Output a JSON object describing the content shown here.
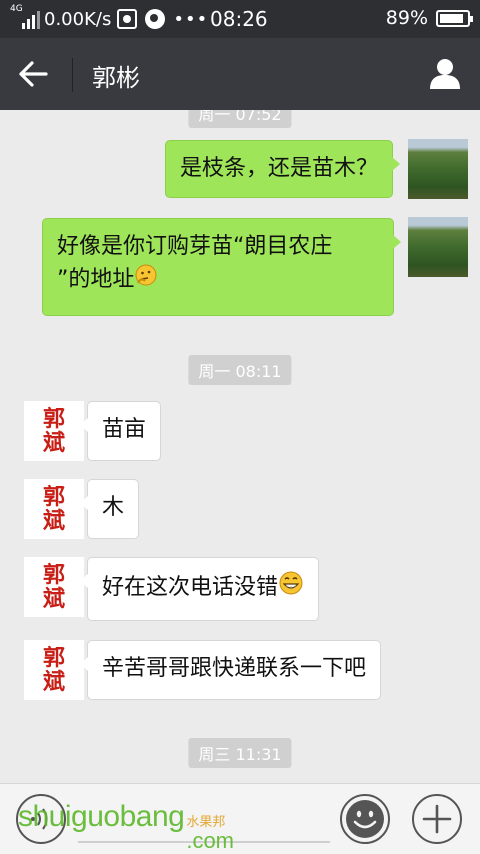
{
  "status_bar": {
    "network_badge": "4G",
    "network_speed": "0.00K/s",
    "more": "•••",
    "time": "08:26",
    "battery_percent": "89%",
    "battery_level": 0.89
  },
  "header": {
    "title": "郭彬",
    "back_icon": "back-arrow-icon",
    "profile_icon": "person-icon"
  },
  "chat": {
    "top_timestamp_partial": "周一 07:52",
    "messages_out": [
      {
        "text": "是枝条，还是苗木？"
      },
      {
        "text_line1": "好像是你订购芽苗“朗目农庄",
        "text_line2": "”的地址",
        "emoji": "thinking-face"
      }
    ],
    "timestamp_1": "周一 08:11",
    "messages_in": [
      {
        "text": "苗亩"
      },
      {
        "text": "木"
      },
      {
        "text": "好在这次电话没错",
        "emoji": "grinning-face"
      },
      {
        "text": "辛苦哥哥跟快递联系一下吧"
      }
    ],
    "timestamp_2": "周三 11:31",
    "seal_text": [
      "郭",
      "斌"
    ]
  },
  "input_bar": {
    "voice_icon": "voice-icon",
    "emoji_icon": "smiley-icon",
    "plus_icon": "plus-icon"
  },
  "watermark": {
    "main": "shuiguobang",
    "cn": "水果邦",
    "suffix": ".com"
  },
  "colors": {
    "status_bg": "#2d2f33",
    "header_bg": "#393a3f",
    "chat_bg": "#ebebeb",
    "out_bubble": "#9fe55a",
    "in_bubble": "#ffffff",
    "seal_red": "#c81e16",
    "watermark_green": "#5cb82a"
  }
}
